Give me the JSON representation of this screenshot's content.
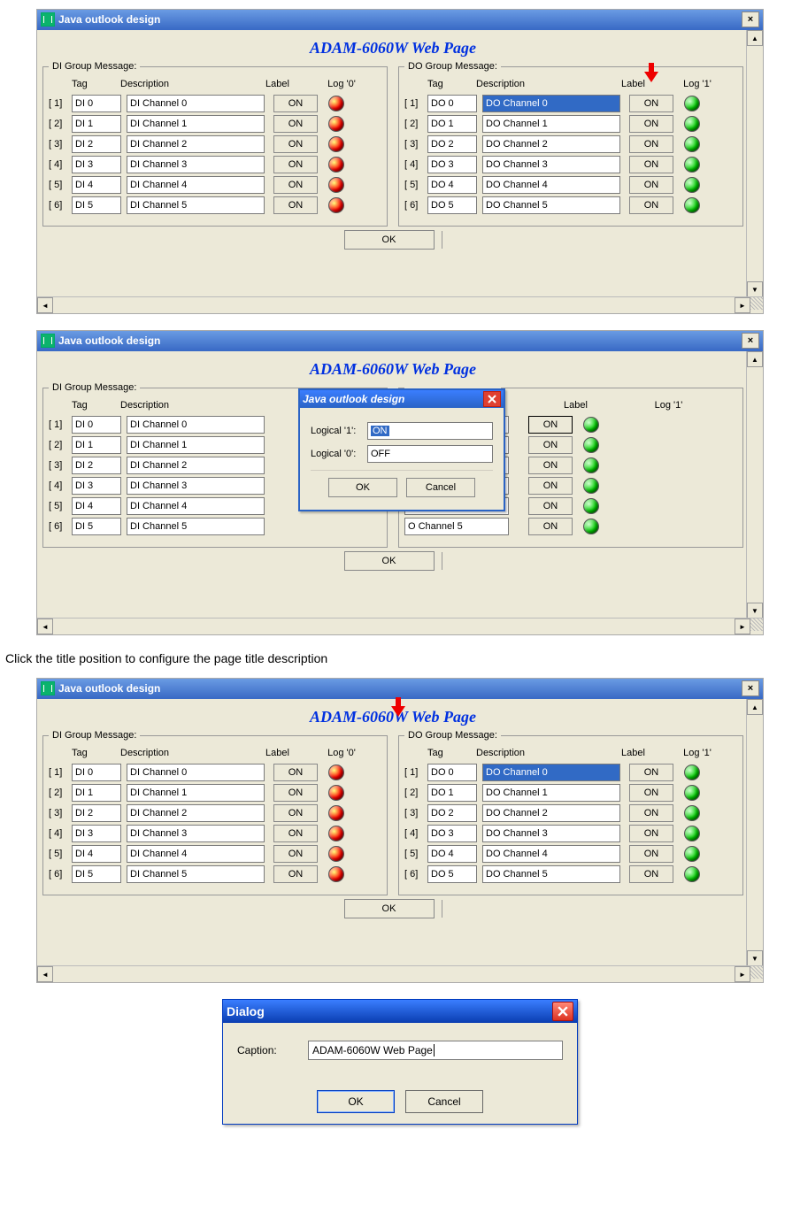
{
  "window": {
    "title": "Java outlook design",
    "close_glyph": "×"
  },
  "scroll": {
    "up": "▲",
    "down": "▼",
    "left": "◄",
    "right": "►"
  },
  "page_title": "ADAM-6060W Web Page",
  "headers": {
    "tag": "Tag",
    "desc": "Description",
    "label": "Label",
    "log0": "Log '0'",
    "log1": "Log '1'"
  },
  "di": {
    "legend": "DI Group Message:",
    "rows": [
      {
        "idx": "[ 1]",
        "tag": "DI 0",
        "desc": "DI Channel 0",
        "label": "ON"
      },
      {
        "idx": "[ 2]",
        "tag": "DI 1",
        "desc": "DI Channel 1",
        "label": "ON"
      },
      {
        "idx": "[ 3]",
        "tag": "DI 2",
        "desc": "DI Channel 2",
        "label": "ON"
      },
      {
        "idx": "[ 4]",
        "tag": "DI 3",
        "desc": "DI Channel 3",
        "label": "ON"
      },
      {
        "idx": "[ 5]",
        "tag": "DI 4",
        "desc": "DI Channel 4",
        "label": "ON"
      },
      {
        "idx": "[ 6]",
        "tag": "DI 5",
        "desc": "DI Channel 5",
        "label": "ON"
      }
    ]
  },
  "do": {
    "legend": "DO Group Message:",
    "rows": [
      {
        "idx": "[ 1]",
        "tag": "DO 0",
        "desc": "DO Channel 0",
        "label": "ON"
      },
      {
        "idx": "[ 2]",
        "tag": "DO 1",
        "desc": "DO Channel 1",
        "label": "ON"
      },
      {
        "idx": "[ 3]",
        "tag": "DO 2",
        "desc": "DO Channel 2",
        "label": "ON"
      },
      {
        "idx": "[ 4]",
        "tag": "DO 3",
        "desc": "DO Channel 3",
        "label": "ON"
      },
      {
        "idx": "[ 5]",
        "tag": "DO 4",
        "desc": "DO Channel 4",
        "label": "ON"
      },
      {
        "idx": "[ 6]",
        "tag": "DO 5",
        "desc": "DO Channel 5",
        "label": "ON"
      }
    ]
  },
  "do_partial": {
    "rows": [
      {
        "desc": "O Channel 0",
        "label": "ON"
      },
      {
        "desc": "O Channel 1",
        "label": "ON"
      },
      {
        "desc": "O Channel 2",
        "label": "ON"
      },
      {
        "desc": "O Channel 3",
        "label": "ON"
      },
      {
        "desc": "O Channel 4",
        "label": "ON"
      },
      {
        "desc": "O Channel 5",
        "label": "ON"
      }
    ]
  },
  "ok_label": "OK",
  "popup": {
    "title": "Java outlook design",
    "l1_label": "Logical '1':",
    "l1_value": "ON",
    "l0_label": "Logical '0':",
    "l0_value": "OFF",
    "ok": "OK",
    "cancel": "Cancel"
  },
  "caption_text": "Click the title position to configure the page title description",
  "dialog": {
    "title": "Dialog",
    "caption_label": "Caption:",
    "caption_value": "ADAM-6060W Web Page",
    "ok": "OK",
    "cancel": "Cancel"
  }
}
